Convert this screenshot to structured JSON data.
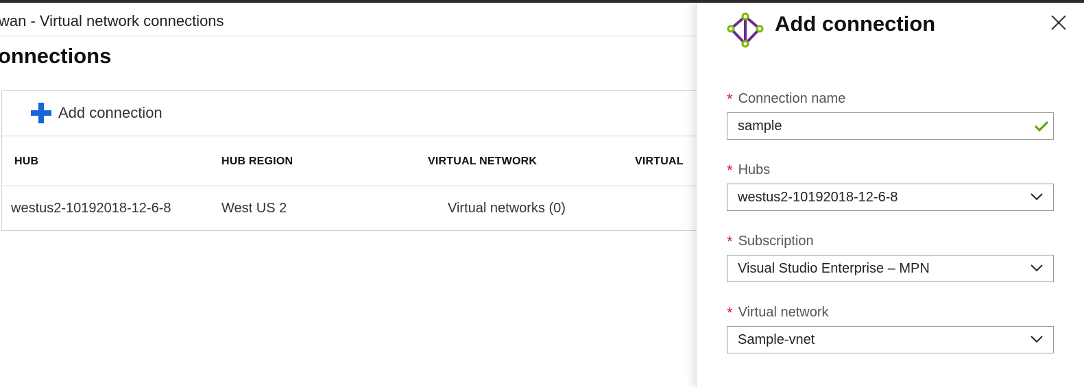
{
  "breadcrumb": "wan - Virtual network connections",
  "page_title": "onnections",
  "toolbar": {
    "add_label": "Add connection"
  },
  "table": {
    "headers": [
      "HUB",
      "HUB REGION",
      "VIRTUAL NETWORK",
      "VIRTUAL"
    ],
    "rows": [
      {
        "hub": "westus2-10192018-12-6-8",
        "region": "West US 2",
        "vnet": "Virtual networks (0)"
      }
    ]
  },
  "pane": {
    "title": "Add connection",
    "icon": "virtual-wan-connection-icon",
    "close_icon": "close-icon",
    "fields": [
      {
        "label": "Connection name",
        "value": "sample",
        "required": "*",
        "status_icon": "checkmark-icon"
      },
      {
        "label": "Hubs",
        "value": "westus2-10192018-12-6-8",
        "required": "*"
      },
      {
        "label": "Subscription",
        "value": "Visual Studio Enterprise – MPN",
        "required": "*"
      },
      {
        "label": "Virtual network",
        "value": "Sample-vnet",
        "required": "*"
      }
    ]
  },
  "colors": {
    "accent": "#1666d6",
    "required": "#d01c2a",
    "valid": "#57a300",
    "icon_purple": "#6b2c91",
    "icon_green": "#7ab800"
  }
}
